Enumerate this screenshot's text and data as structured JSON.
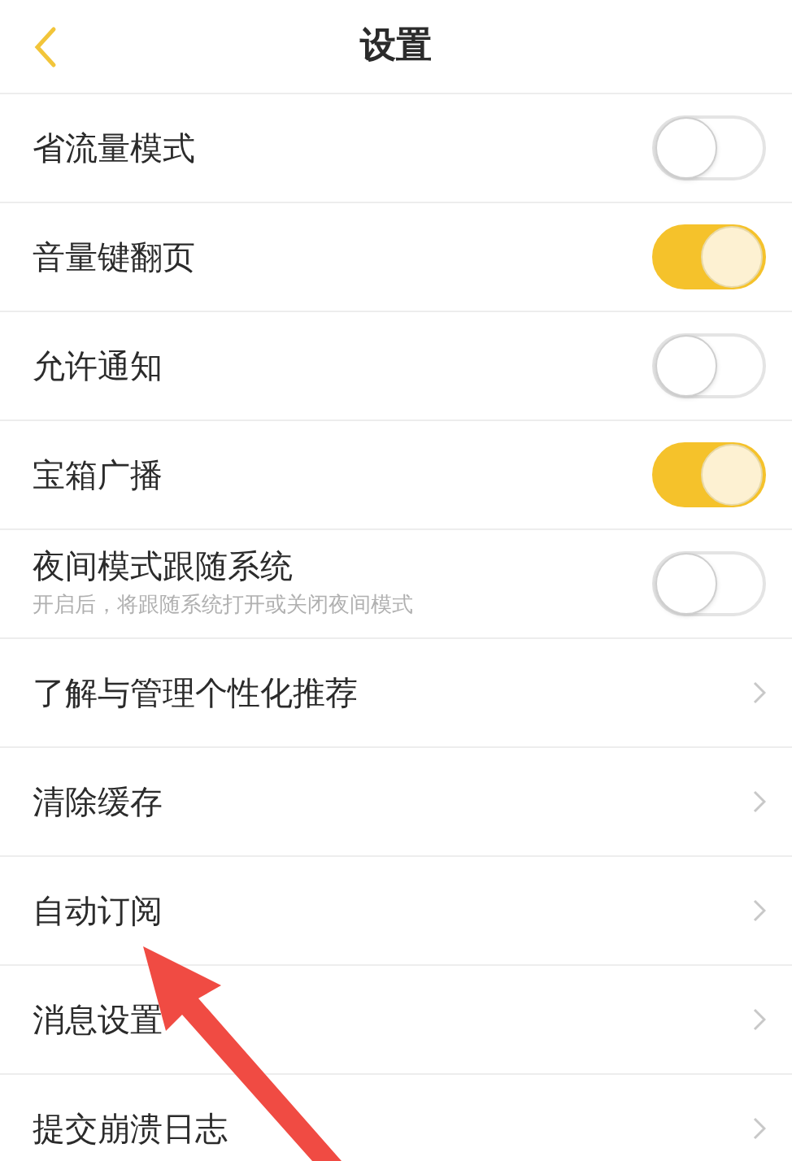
{
  "header": {
    "title": "设置"
  },
  "rows": [
    {
      "kind": "toggle",
      "label": "省流量模式",
      "on": false
    },
    {
      "kind": "toggle",
      "label": "音量键翻页",
      "on": true
    },
    {
      "kind": "toggle",
      "label": "允许通知",
      "on": false
    },
    {
      "kind": "toggle",
      "label": "宝箱广播",
      "on": true
    },
    {
      "kind": "toggle",
      "label": "夜间模式跟随系统",
      "on": false,
      "description": "开启后，将跟随系统打开或关闭夜间模式"
    },
    {
      "kind": "link",
      "label": "了解与管理个性化推荐"
    },
    {
      "kind": "link",
      "label": "清除缓存"
    },
    {
      "kind": "link",
      "label": "自动订阅"
    },
    {
      "kind": "link",
      "label": "消息设置"
    },
    {
      "kind": "link",
      "label": "提交崩溃日志"
    }
  ]
}
